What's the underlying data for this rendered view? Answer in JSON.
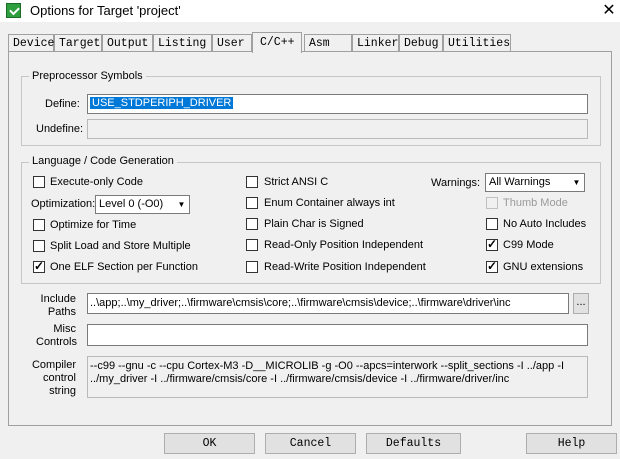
{
  "window": {
    "title": "Options for Target 'project'",
    "close_glyph": "✕"
  },
  "tabs": [
    {
      "label": "Device"
    },
    {
      "label": "Target"
    },
    {
      "label": "Output"
    },
    {
      "label": "Listing"
    },
    {
      "label": "User"
    },
    {
      "label": "C/C++",
      "active": true
    },
    {
      "label": "Asm"
    },
    {
      "label": "Linker"
    },
    {
      "label": "Debug"
    },
    {
      "label": "Utilities"
    }
  ],
  "preprocessor": {
    "legend": "Preprocessor Symbols",
    "define_label": "Define:",
    "define_value": "USE_STDPERIPH_DRIVER",
    "undefine_label": "Undefine:",
    "undefine_value": ""
  },
  "language": {
    "legend": "Language / Code Generation",
    "execute_only": {
      "label": "Execute-only Code",
      "checked": false
    },
    "optimization_label": "Optimization:",
    "optimization_value": "Level 0 (-O0)",
    "optimize_time": {
      "label": "Optimize for Time",
      "checked": false
    },
    "split_load": {
      "label": "Split Load and Store Multiple",
      "checked": false
    },
    "one_elf": {
      "label": "One ELF Section per Function",
      "checked": true
    },
    "strict_ansi": {
      "label": "Strict ANSI C",
      "checked": false
    },
    "enum_int": {
      "label": "Enum Container always int",
      "checked": false
    },
    "plain_char": {
      "label": "Plain Char is Signed",
      "checked": false
    },
    "ro_pi": {
      "label": "Read-Only Position Independent",
      "checked": false
    },
    "rw_pi": {
      "label": "Read-Write Position Independent",
      "checked": false
    },
    "warnings_label": "Warnings:",
    "warnings_value": "All Warnings",
    "thumb_mode": {
      "label": "Thumb Mode",
      "checked": false,
      "disabled": true
    },
    "no_auto_includes": {
      "label": "No Auto Includes",
      "checked": false
    },
    "c99_mode": {
      "label": "C99 Mode",
      "checked": true
    },
    "gnu_ext": {
      "label": "GNU extensions",
      "checked": true
    }
  },
  "paths": {
    "include_label": "Include\nPaths",
    "include_value": "..\\app;..\\my_driver;..\\firmware\\cmsis\\core;..\\firmware\\cmsis\\device;..\\firmware\\driver\\inc",
    "browse_label": "...",
    "misc_label": "Misc\nControls",
    "misc_value": "",
    "compiler_label": "Compiler\ncontrol\nstring",
    "compiler_value": "--c99 --gnu -c --cpu Cortex-M3 -D__MICROLIB -g -O0 --apcs=interwork --split_sections -I ../app -I\n../my_driver -I ../firmware/cmsis/core -I ../firmware/cmsis/device -I ../firmware/driver/inc"
  },
  "buttons": {
    "ok": "OK",
    "cancel": "Cancel",
    "defaults": "Defaults",
    "help": "Help"
  },
  "icons": {
    "app": "keil-check-icon",
    "dropdown": "▼"
  }
}
